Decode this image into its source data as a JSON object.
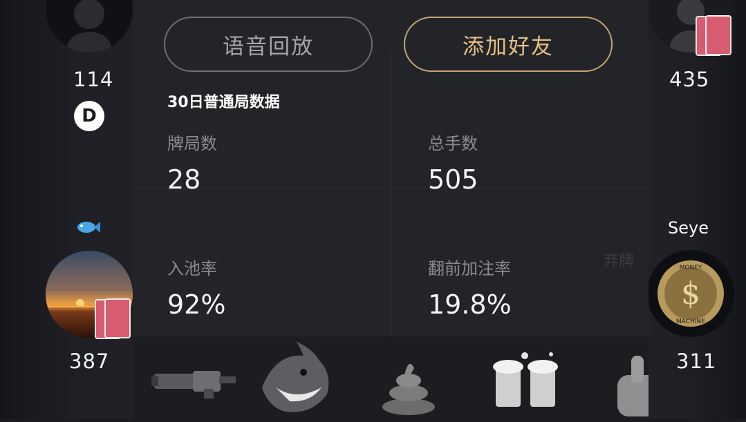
{
  "seats": {
    "top_left": {
      "score": "114",
      "dealer_label": "D"
    },
    "top_right": {
      "score": "435"
    },
    "bottom_left": {
      "score": "387"
    },
    "bottom_right": {
      "name": "Seye",
      "score": "311",
      "badge_text_top": "MONEY",
      "badge_text_bottom": "MACHINE"
    }
  },
  "panel": {
    "replay_button": "语音回放",
    "add_friend_button": "添加好友",
    "section_title": "30日普通局数据",
    "stats": [
      {
        "label": "牌局数",
        "value": "28"
      },
      {
        "label": "总手数",
        "value": "505"
      },
      {
        "label": "入池率",
        "value": "92%"
      },
      {
        "label": "翻前加注率",
        "value": "19.8%"
      }
    ]
  },
  "background_hint": "弃牌",
  "emojis": [
    "minigun-emoji",
    "shark-emoji",
    "poop-emoji",
    "beer-cheers-emoji",
    "thumbs-up-emoji"
  ],
  "colors": {
    "panel_bg": "#232427",
    "accent_gold": "#e3bf86",
    "card_red": "#d75c70"
  }
}
